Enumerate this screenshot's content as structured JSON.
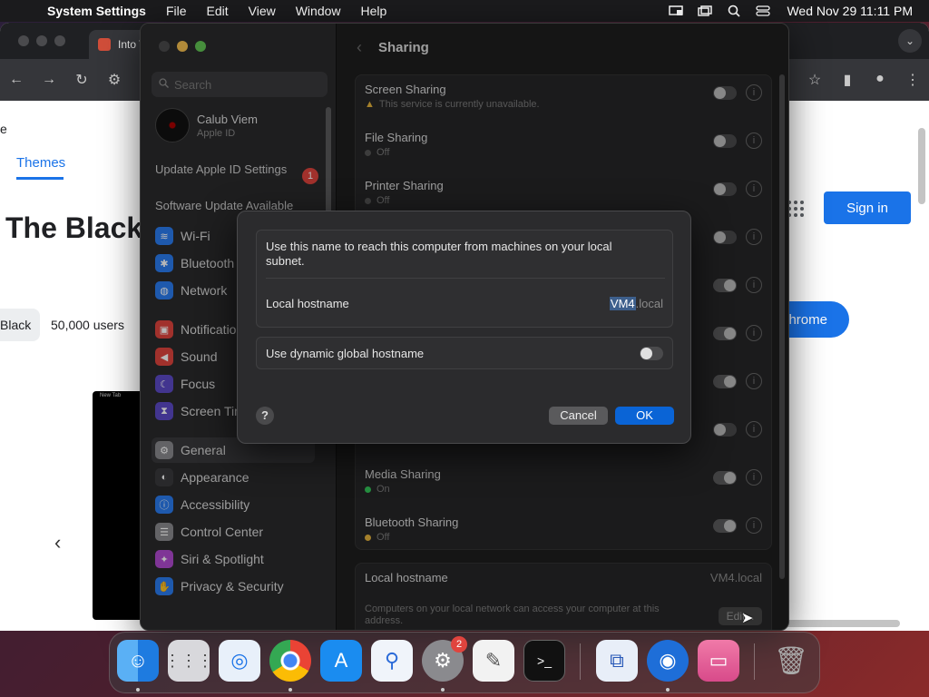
{
  "menubar": {
    "app_name": "System Settings",
    "menus": [
      "File",
      "Edit",
      "View",
      "Window",
      "Help"
    ],
    "clock": "Wed Nov 29  11:11 PM"
  },
  "chrome": {
    "tab_title": "Into T",
    "page": {
      "e_fragment": "e",
      "themes_tab": "Themes",
      "title_fragment": "The Black",
      "chip_label": "Black",
      "users_label": "50,000 users",
      "sign_in": "Sign in",
      "add_button": "hrome",
      "preview_tab": "New Tab"
    }
  },
  "settings": {
    "search_placeholder": "Search",
    "account": {
      "name": "Calub Viem",
      "subtitle": "Apple ID"
    },
    "suggestions": [
      {
        "label": "Update Apple ID Settings",
        "badge": "1"
      },
      {
        "label": "Software Update Available",
        "badge": ""
      }
    ],
    "sidebar": [
      {
        "label": "Wi-Fi",
        "color": "#2a7cf0"
      },
      {
        "label": "Bluetooth",
        "color": "#2a7cf0"
      },
      {
        "label": "Network",
        "color": "#2a7cf0"
      },
      {
        "label": "Notifications",
        "color": "#e0443e"
      },
      {
        "label": "Sound",
        "color": "#e0443e"
      },
      {
        "label": "Focus",
        "color": "#5c4ac7"
      },
      {
        "label": "Screen Time",
        "color": "#5c4ac7"
      },
      {
        "label": "General",
        "color": "#8a8a8e"
      },
      {
        "label": "Appearance",
        "color": "#3a3a3c"
      },
      {
        "label": "Accessibility",
        "color": "#2a7cf0"
      },
      {
        "label": "Control Center",
        "color": "#8a8a8e"
      },
      {
        "label": "Siri & Spotlight",
        "color": "#b04ad0"
      },
      {
        "label": "Privacy & Security",
        "color": "#2a7cf0"
      }
    ],
    "header_title": "Sharing",
    "rows": [
      {
        "label": "Screen Sharing",
        "status": "This service is currently unavailable.",
        "state": "warn",
        "on": false
      },
      {
        "label": "File Sharing",
        "status": "Off",
        "state": "off",
        "on": false
      },
      {
        "label": "Printer Sharing",
        "status": "Off",
        "state": "off",
        "on": false
      },
      {
        "label": "Media Sharing",
        "status": "On",
        "state": "on",
        "on": true
      },
      {
        "label": "Bluetooth Sharing",
        "status": "Off",
        "state": "off",
        "on": true
      }
    ],
    "local_hostname": {
      "label": "Local hostname",
      "value": "VM4.local",
      "description": "Computers on your local network can access your computer at this address.",
      "edit_label": "Edit..."
    }
  },
  "sheet": {
    "description": "Use this name to reach this computer from machines on your local subnet.",
    "hostname_label": "Local hostname",
    "hostname_value": "VM4",
    "hostname_suffix": ".local",
    "dynamic_label": "Use dynamic global hostname",
    "dynamic_on": false,
    "help": "?",
    "cancel": "Cancel",
    "ok": "OK"
  },
  "dock": {
    "items": [
      "Finder",
      "Launchpad",
      "Safari",
      "Chrome",
      "App Store",
      "Xcode Instruments",
      "System Settings",
      "TextEdit",
      "Terminal",
      "Remote Desktop",
      "Proxyman",
      "Screen Sharing",
      "Trash"
    ],
    "settings_badge": "2"
  }
}
